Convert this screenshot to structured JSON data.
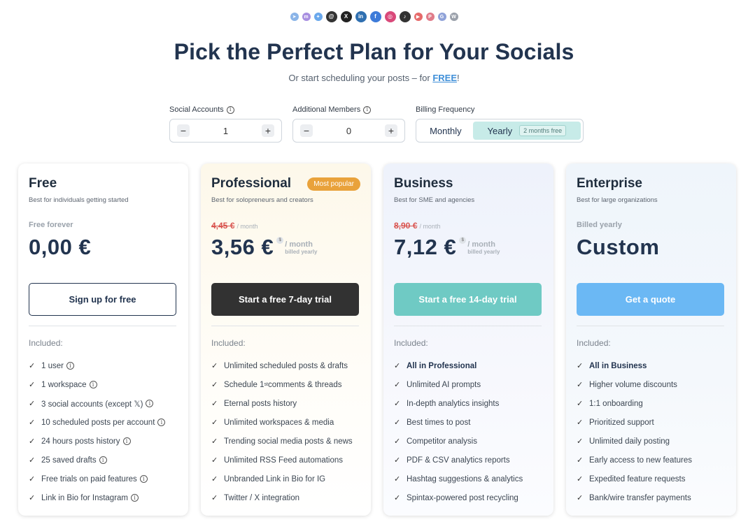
{
  "social_icons": [
    {
      "name": "telegram-icon",
      "color": "#8ab4e8",
      "glyph": "➤",
      "size": "small"
    },
    {
      "name": "mastodon-icon",
      "color": "#a88fe0",
      "glyph": "m",
      "size": "small"
    },
    {
      "name": "bluesky-icon",
      "color": "#6aa8ec",
      "glyph": "✦",
      "size": "small"
    },
    {
      "name": "threads-icon",
      "color": "#333333",
      "glyph": "@",
      "size": "normal"
    },
    {
      "name": "x-icon",
      "color": "#222222",
      "glyph": "X",
      "size": "normal"
    },
    {
      "name": "linkedin-icon",
      "color": "#2f6fb0",
      "glyph": "in",
      "size": "normal"
    },
    {
      "name": "facebook-icon",
      "color": "#3d7bd9",
      "glyph": "f",
      "size": "normal"
    },
    {
      "name": "instagram-icon",
      "color": "#d9497a",
      "glyph": "◎",
      "size": "normal"
    },
    {
      "name": "tiktok-icon",
      "color": "#333333",
      "glyph": "♪",
      "size": "normal"
    },
    {
      "name": "youtube-icon",
      "color": "#e66a6a",
      "glyph": "▶",
      "size": "small"
    },
    {
      "name": "pinterest-icon",
      "color": "#e07c8a",
      "glyph": "P",
      "size": "small"
    },
    {
      "name": "google-business-icon",
      "color": "#8fa2d8",
      "glyph": "G",
      "size": "small"
    },
    {
      "name": "wordpress-icon",
      "color": "#9aa0aa",
      "glyph": "W",
      "size": "small"
    }
  ],
  "header": {
    "title": "Pick the Perfect Plan for Your Socials",
    "subtitle_prefix": "Or start scheduling your posts – for ",
    "subtitle_link": "FREE",
    "subtitle_suffix": "!"
  },
  "controls": {
    "social_accounts": {
      "label": "Social Accounts",
      "value": "1",
      "minus": "−",
      "plus": "+"
    },
    "additional_members": {
      "label": "Additional Members",
      "value": "0",
      "minus": "−",
      "plus": "+"
    },
    "billing": {
      "label": "Billing Frequency",
      "monthly": "Monthly",
      "yearly": "Yearly",
      "yearly_badge": "2 months free",
      "selected": "Yearly"
    }
  },
  "plans": {
    "free": {
      "name": "Free",
      "desc": "Best for individuals getting started",
      "price_top": "Free forever",
      "price": "0,00 €",
      "cta": "Sign up for free",
      "included": "Included:",
      "features": [
        "1 user",
        "1 workspace",
        "3 social accounts (except 𝕏)",
        "10 scheduled posts per account",
        "24 hours posts history",
        "25 saved drafts",
        "Free trials on paid features",
        "Link in Bio for Instagram"
      ]
    },
    "professional": {
      "name": "Professional",
      "badge": "Most popular",
      "desc": "Best for solopreneurs and creators",
      "old_price": "4,45 €",
      "old_per": "/ month",
      "price": "3,56 €",
      "per": "/ month",
      "billed": "billed yearly",
      "cta": "Start a free 7-day trial",
      "included": "Included:",
      "features": [
        "Unlimited scheduled posts & drafts",
        "Schedule 1",
        "Eternal posts history",
        "Unlimited workspaces & media",
        "Trending social media posts & news",
        "Unlimited RSS Feed automations",
        "Unbranded Link in Bio for IG",
        "Twitter / X integration"
      ],
      "feature2_sup": "st",
      "feature2_rest": " comments & threads"
    },
    "business": {
      "name": "Business",
      "desc": "Best for SME and agencies",
      "old_price": "8,90 €",
      "old_per": "/ month",
      "price": "7,12 €",
      "per": "/ month",
      "billed": "billed yearly",
      "cta": "Start a free 14-day trial",
      "included": "Included:",
      "features": [
        "All in Professional",
        "Unlimited AI prompts",
        "In-depth analytics insights",
        "Best times to post",
        "Competitor analysis",
        "PDF & CSV analytics reports",
        "Hashtag suggestions & analytics",
        "Spintax-powered post recycling"
      ]
    },
    "enterprise": {
      "name": "Enterprise",
      "desc": "Best for large organizations",
      "price_top": "Billed yearly",
      "price": "Custom",
      "cta": "Get a quote",
      "included": "Included:",
      "features": [
        "All in Business",
        "Higher volume discounts",
        "1:1 onboarding",
        "Prioritized support",
        "Unlimited daily posting",
        "Early access to new features",
        "Expedited feature requests",
        "Bank/wire transfer payments"
      ]
    }
  },
  "icons": {
    "check": "✓",
    "info": "i",
    "dollar": "$"
  }
}
